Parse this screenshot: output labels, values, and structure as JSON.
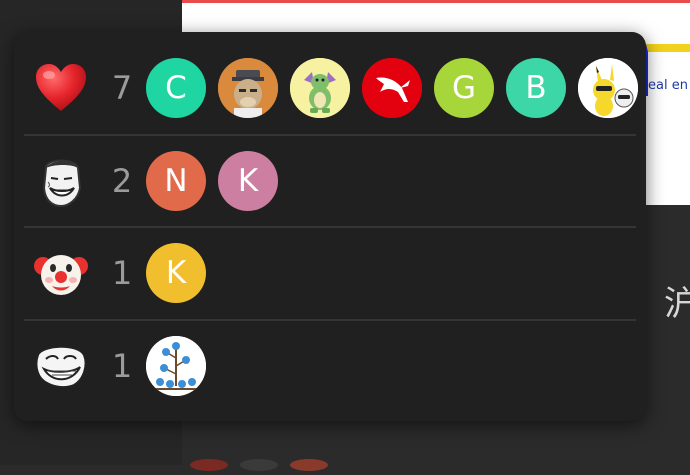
{
  "background": {
    "visible_snippet": "eal en",
    "visible_glyph": "沪"
  },
  "reactions": [
    {
      "emoji": "heart-icon",
      "count": "7",
      "avatars": [
        {
          "kind": "letter",
          "letter": "C",
          "color": "#1fd6a2"
        },
        {
          "kind": "image",
          "icon": "ape-avatar-icon"
        },
        {
          "kind": "image",
          "icon": "dragon-avatar-icon"
        },
        {
          "kind": "image",
          "icon": "kangaroo-logo-avatar-icon"
        },
        {
          "kind": "letter",
          "letter": "G",
          "color": "#a7d63a"
        },
        {
          "kind": "letter",
          "letter": "B",
          "color": "#3dd6a6"
        },
        {
          "kind": "image",
          "icon": "pikachu-avatar-icon"
        }
      ]
    },
    {
      "emoji": "yao-ming-face-icon",
      "count": "2",
      "avatars": [
        {
          "kind": "letter",
          "letter": "N",
          "color": "#e06a4a"
        },
        {
          "kind": "letter",
          "letter": "K",
          "color": "#cc7fa0"
        }
      ]
    },
    {
      "emoji": "clown-face-icon",
      "count": "1",
      "avatars": [
        {
          "kind": "letter",
          "letter": "K",
          "color": "#f1bf2d"
        }
      ]
    },
    {
      "emoji": "troll-face-icon",
      "count": "1",
      "avatars": [
        {
          "kind": "image",
          "icon": "birds-tree-avatar-icon"
        }
      ]
    }
  ]
}
